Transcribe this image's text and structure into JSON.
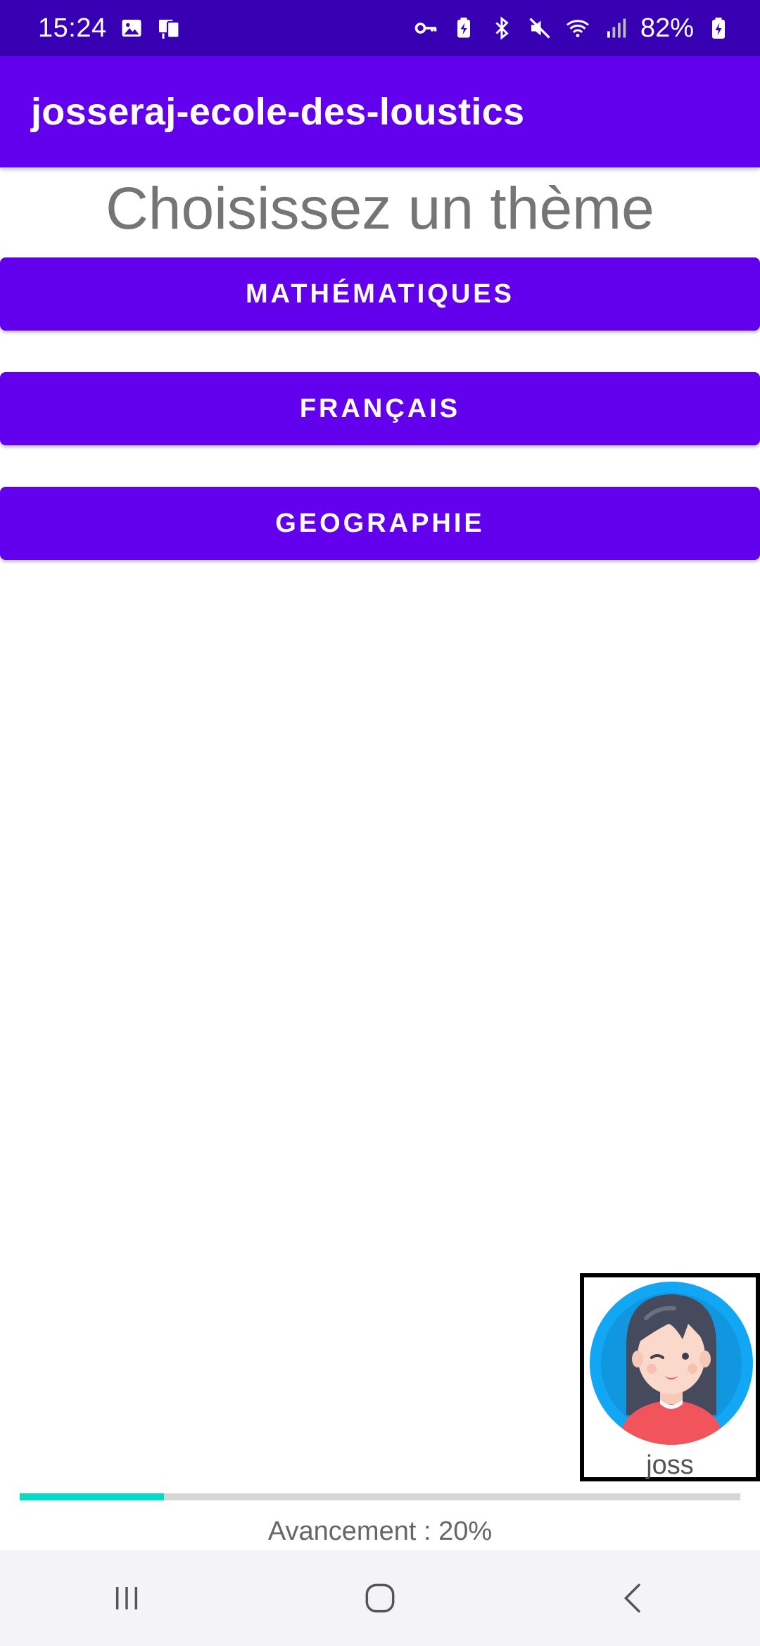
{
  "status_bar": {
    "time": "15:24",
    "battery": "82%",
    "icons": [
      "image-icon",
      "cast-icon",
      "vpn-key-icon",
      "battery-saver-icon",
      "bluetooth-icon",
      "mute-icon",
      "wifi-icon",
      "signal-icon",
      "battery-charging-icon"
    ]
  },
  "app_bar": {
    "title": "josseraj-ecole-des-loustics"
  },
  "main": {
    "heading": "Choisissez un thème",
    "buttons": [
      {
        "label": "MATHÉMATIQUES"
      },
      {
        "label": "FRANÇAIS"
      },
      {
        "label": "GEOGRAPHIE"
      }
    ]
  },
  "user": {
    "name": "joss",
    "avatar_icon": "girl-avatar-icon"
  },
  "progress": {
    "value": 20,
    "label": "Avancement : 20%"
  },
  "nav_bar": {
    "icons": [
      "recent-apps-icon",
      "home-icon",
      "back-icon"
    ]
  },
  "colors": {
    "status_bar": "#3700B3",
    "primary": "#6200EE",
    "accent": "#03DAC5",
    "avatar_bg": "#12A7F5"
  }
}
